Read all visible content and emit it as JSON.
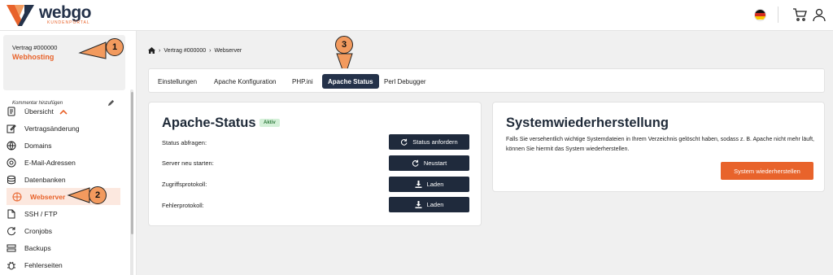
{
  "header": {
    "logo_word": "webgo",
    "logo_sub": "KUNDENPORTAL",
    "language_flag": "de-flag-icon",
    "cart_icon": "cart-icon",
    "user_icon": "user-icon"
  },
  "sidebar": {
    "contract_label": "Vertrag #000000",
    "contract_name": "Webhosting",
    "comment_label": "Kommentar hinzufügen",
    "items": [
      {
        "label": "Übersicht",
        "icon": "doc-icon"
      },
      {
        "label": "Vertragsänderung",
        "icon": "edit-icon"
      },
      {
        "label": "Domains",
        "icon": "globe-icon"
      },
      {
        "label": "E-Mail-Adressen",
        "icon": "mail-icon"
      },
      {
        "label": "Datenbanken",
        "icon": "database-icon"
      },
      {
        "label": "Webserver",
        "icon": "server-icon"
      },
      {
        "label": "SSH / FTP",
        "icon": "file-icon"
      },
      {
        "label": "Cronjobs",
        "icon": "refresh-icon"
      },
      {
        "label": "Backups",
        "icon": "backup-icon"
      },
      {
        "label": "Fehlerseiten",
        "icon": "bug-icon"
      }
    ]
  },
  "annotations": {
    "one": "1",
    "two": "2",
    "three": "3"
  },
  "breadcrumb": {
    "item1": "Vertrag #000000",
    "item2": "Webserver"
  },
  "tabs": [
    {
      "label": "Einstellungen"
    },
    {
      "label": "Apache Konfiguration"
    },
    {
      "label": "PHP.ini"
    },
    {
      "label": "Apache Status"
    },
    {
      "label": "Perl Debugger"
    }
  ],
  "apache": {
    "title": "Apache-Status",
    "status_badge": "Aktiv",
    "rows": [
      {
        "label": "Status abfragen:",
        "button": "Status anfordern"
      },
      {
        "label": "Server neu starten:",
        "button": "Neustart"
      },
      {
        "label": "Zugriffsprotokoll:",
        "button": "Laden"
      },
      {
        "label": "Fehlerprotokoll:",
        "button": "Laden"
      }
    ]
  },
  "restore": {
    "title": "Systemwiederherstellung",
    "description": "Falls Sie versehentlich wichtige Systemdateien in Ihrem Verzeichnis gelöscht haben, sodass z. B. Apache nicht mehr läuft, können Sie hiermit das System wiederherstellen.",
    "button": "System wiederherstellen"
  },
  "colors": {
    "accent": "#e8632b",
    "dark": "#1f2a3c",
    "badge": "#f29a5e"
  }
}
